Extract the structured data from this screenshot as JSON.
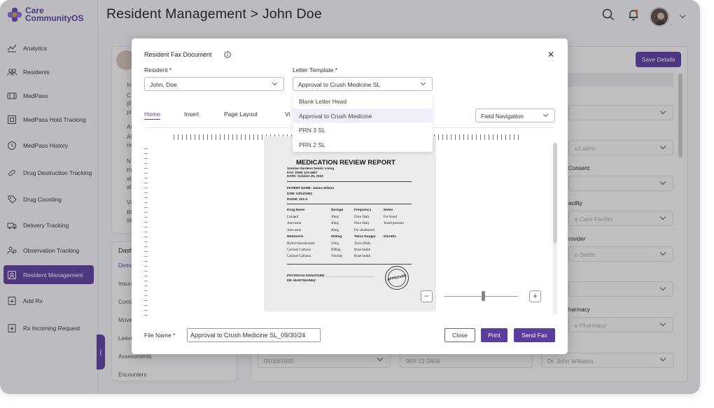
{
  "app": {
    "logo_line1": "Care",
    "logo_line2": "CommunityOS",
    "accent": "#5b3d9e"
  },
  "header": {
    "title": "Resident Management > John Doe"
  },
  "sidebar": {
    "items": [
      {
        "label": "Analytics",
        "icon": "analytics-icon"
      },
      {
        "label": "Residents",
        "icon": "residents-icon"
      },
      {
        "label": "MedPass",
        "icon": "medpass-icon"
      },
      {
        "label": "MedPass Hold Tracking",
        "icon": "hold-tracking-icon"
      },
      {
        "label": "MedPass History",
        "icon": "history-icon"
      },
      {
        "label": "Drug Destruction Tracking",
        "icon": "destruction-icon"
      },
      {
        "label": "Drug Counting",
        "icon": "tag-icon"
      },
      {
        "label": "Delivery Tracking",
        "icon": "truck-icon"
      },
      {
        "label": "Observation Tracking",
        "icon": "observation-icon"
      },
      {
        "label": "Resident Management",
        "icon": "resident-management-icon",
        "active": true
      },
      {
        "label": "Add Rx",
        "icon": "add-rx-icon"
      },
      {
        "label": "Rx Incoming Request",
        "icon": "incoming-request-icon"
      }
    ]
  },
  "background": {
    "save_label": "Save Details",
    "dash_label": "Dash",
    "dash_items": [
      "Demo",
      "Insura",
      "Conta",
      "Move",
      "Leave",
      "Assessments",
      "Encounters"
    ],
    "left_snippets": [
      "In",
      "C",
      "(F",
      "pl",
      "Al",
      "Al",
      "ne",
      "N",
      "Pr",
      "at",
      "al",
      "Vi",
      "Bl",
      "98"
    ],
    "right_fields": [
      {
        "label": "",
        "value": "c/Latino"
      },
      {
        "label": "Consent:",
        "value": ""
      },
      {
        "label": "acility",
        "value": "e Care Facility"
      },
      {
        "label": "rovider",
        "value": "n Smith"
      },
      {
        "label": "harmacy",
        "value": "s Pharmacy"
      }
    ],
    "bottom_row": {
      "dob": "05/10/1980",
      "phone": "900-12-3456",
      "doctor": "Dr. John Williams"
    }
  },
  "modal": {
    "title": "Resident Fax Document",
    "resident_label": "Resident *",
    "resident_value": "John, Doe",
    "template_label": "Letter Template *",
    "template_value": "Approval to Crush Medicine SL",
    "template_options": [
      "Blank Letter Head",
      "Approval to Crush Medicine",
      "PRN 3 SL",
      "PRN 2 SL"
    ],
    "tabs": [
      "Home",
      "Insert",
      "Page Layout",
      "Vi"
    ],
    "field_navigation": "Field Navigation",
    "file_name_label": "File Name *",
    "file_name_value": "Approval to Crush Medicine SL_09/30/24",
    "close_label": "Close",
    "print_label": "Print",
    "send_fax_label": "Send Fax",
    "zoom_minus": "−",
    "zoom_plus": "+",
    "zoom_level": 0.53
  },
  "document": {
    "title": "MEDICATION REVIEW REPORT",
    "facility": "Sunrise Gardens Senior Living",
    "fax": "FAX: (555) 123-4567",
    "date": "DATE: October 26, 2023",
    "patient": "PATIENT NAME: James Wilson",
    "dob": "DOB: 03/14/1952",
    "room": "ROOM: 112-A",
    "columns": [
      "Drug Name",
      "Dosage",
      "Frequency",
      "Notes"
    ],
    "rows": [
      [
        "Lisinpril",
        "10mg",
        "Once Daily",
        "For blood"
      ],
      [
        "Atorvastin",
        "40mg",
        "Once Daily",
        "'blood pressure"
      ],
      [
        "Atorvastin",
        "40mg",
        "For cholesterol",
        ""
      ],
      [
        "Metmorrin",
        "500mg",
        "Twice Daugar",
        "Diuretic"
      ],
      [
        "Hydrochlorothiazide",
        "25mg",
        "Twice Daily",
        ""
      ],
      [
        "Calcium Carbonn",
        "600mg",
        "Bone health",
        ""
      ],
      [
        "Calcium Carbonn",
        "Twicbay",
        "Bone health",
        ""
      ]
    ],
    "signature_label": "PHYSICIAN SIGNATURE: ___________________________",
    "physician": "DR. MARTINAINEZ",
    "stamp_text": "APPROVED"
  }
}
